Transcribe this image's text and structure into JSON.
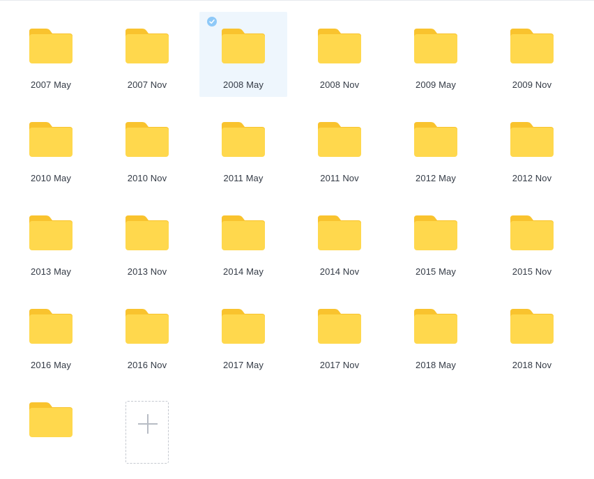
{
  "colors": {
    "folder_body": "#FFD84D",
    "folder_tab": "#F9C32E",
    "selected_bg": "#EEF6FD",
    "check_bg": "#8EC9F8"
  },
  "folders": [
    {
      "name": "2007 May",
      "selected": false
    },
    {
      "name": "2007 Nov",
      "selected": false
    },
    {
      "name": "2008 May",
      "selected": true
    },
    {
      "name": "2008 Nov",
      "selected": false
    },
    {
      "name": "2009 May",
      "selected": false
    },
    {
      "name": "2009 Nov",
      "selected": false
    },
    {
      "name": "2010 May",
      "selected": false
    },
    {
      "name": "2010 Nov",
      "selected": false
    },
    {
      "name": "2011 May",
      "selected": false
    },
    {
      "name": "2011 Nov",
      "selected": false
    },
    {
      "name": "2012 May",
      "selected": false
    },
    {
      "name": "2012 Nov",
      "selected": false
    },
    {
      "name": "2013 May",
      "selected": false
    },
    {
      "name": "2013 Nov",
      "selected": false
    },
    {
      "name": "2014 May",
      "selected": false
    },
    {
      "name": "2014 Nov",
      "selected": false
    },
    {
      "name": "2015 May",
      "selected": false
    },
    {
      "name": "2015 Nov",
      "selected": false
    },
    {
      "name": "2016 May",
      "selected": false
    },
    {
      "name": "2016 Nov",
      "selected": false
    },
    {
      "name": "2017 May",
      "selected": false
    },
    {
      "name": "2017 Nov",
      "selected": false
    },
    {
      "name": "2018 May",
      "selected": false
    },
    {
      "name": "2018 Nov",
      "selected": false
    },
    {
      "name": "",
      "selected": false
    }
  ],
  "add_tile": {
    "icon": "plus-icon"
  }
}
